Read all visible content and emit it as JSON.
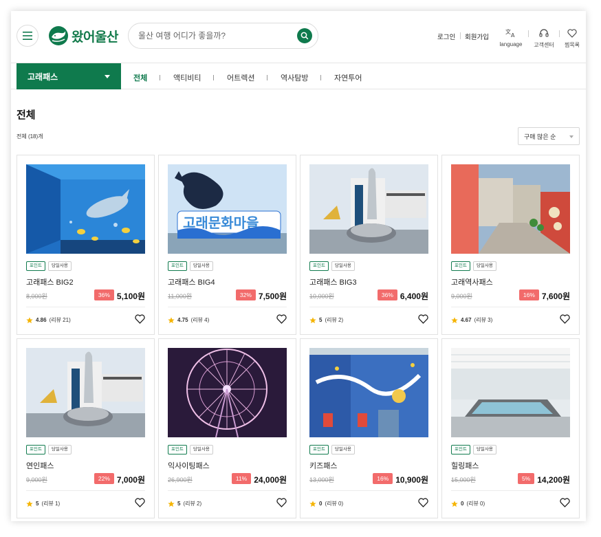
{
  "header": {
    "logo_text": "왔어울산",
    "search_placeholder": "울산 여행 어디가 좋을까?",
    "login": "로그인",
    "signup": "회원가입",
    "utils": [
      {
        "label": "language",
        "icon": "translate-icon"
      },
      {
        "label": "고객센터",
        "icon": "headset-icon"
      },
      {
        "label": "찜목록",
        "icon": "heart-icon"
      }
    ]
  },
  "category": {
    "selected": "고래패스",
    "tabs": [
      "전체",
      "액티비티",
      "어트렉션",
      "역사탐방",
      "자연투어"
    ],
    "active_tab": "전체"
  },
  "section": {
    "title": "전체",
    "count": "전체 (18)개",
    "sort": "구매 많은 순"
  },
  "colors": {
    "brand": "#0f7a4d",
    "discount": "#f26b6b",
    "star": "#f5b400"
  },
  "products": [
    {
      "name": "고래패스 BIG2",
      "tags": [
        "포인트",
        "당일사용"
      ],
      "original": "8,000원",
      "discount": "36%",
      "price": "5,100원",
      "rating": "4.86",
      "reviews": "(리뷰 21)",
      "image": "aquarium-dolphin"
    },
    {
      "name": "고래패스 BIG4",
      "tags": [
        "포인트",
        "당일사용"
      ],
      "original": "11,000원",
      "discount": "32%",
      "price": "7,500원",
      "rating": "4.75",
      "reviews": "(리뷰 4)",
      "image": "whale-sculpture"
    },
    {
      "name": "고래패스 BIG3",
      "tags": [
        "포인트",
        "당일사용"
      ],
      "original": "10,000원",
      "discount": "36%",
      "price": "6,400원",
      "rating": "5",
      "reviews": "(리뷰 2)",
      "image": "whale-museum"
    },
    {
      "name": "고래역사패스",
      "tags": [
        "포인트",
        "당일사용"
      ],
      "original": "9,000원",
      "discount": "16%",
      "price": "7,600원",
      "rating": "4.67",
      "reviews": "(리뷰 3)",
      "image": "mural-alley"
    },
    {
      "name": "연인패스",
      "tags": [
        "포인트",
        "당일사용"
      ],
      "original": "9,000원",
      "discount": "22%",
      "price": "7,000원",
      "rating": "5",
      "reviews": "(리뷰 1)",
      "image": "whale-museum"
    },
    {
      "name": "익사이팅패스",
      "tags": [
        "포인트",
        "당일사용"
      ],
      "original": "26,900원",
      "discount": "11%",
      "price": "24,000원",
      "rating": "5",
      "reviews": "(리뷰 2)",
      "image": "ferris-wheel"
    },
    {
      "name": "키즈패스",
      "tags": [
        "포인트",
        "당일사용"
      ],
      "original": "13,000원",
      "discount": "16%",
      "price": "10,900원",
      "rating": "0",
      "reviews": "(리뷰 0)",
      "image": "blue-mural"
    },
    {
      "name": "힐링패스",
      "tags": [
        "포인트",
        "당일사용"
      ],
      "original": "15,000원",
      "discount": "5%",
      "price": "14,200원",
      "rating": "0",
      "reviews": "(리뷰 0)",
      "image": "bath-pool"
    }
  ]
}
